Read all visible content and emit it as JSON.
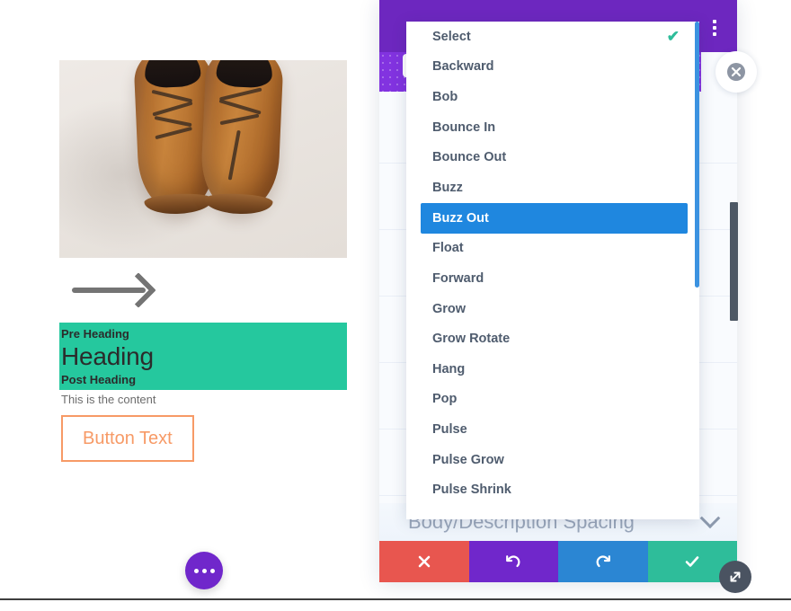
{
  "preview": {
    "photo_alt": "brown-leather-dress-shoes",
    "arrow_icon": "arrow-right-icon",
    "pre_heading": "Pre Heading",
    "heading": "Heading",
    "post_heading": "Post Heading",
    "content": "This is the content",
    "button_label": "Button Text",
    "fab_icon": "ellipsis-icon",
    "colors": {
      "heading_block_bg": "#25c89e",
      "button_border": "#f79a66",
      "button_text": "#f79a66",
      "arrow": "#747474",
      "fab_bg": "#7027cb"
    }
  },
  "modal": {
    "header_menu_icon": "vertical-ellipsis-icon",
    "row_menu_icon": "vertical-ellipsis-icon",
    "close_icon": "close-circle-icon",
    "resize_icon": "resize-diagonal-icon",
    "spacing_row": {
      "label": "Body/Description Spacing",
      "toggle_icon": "chevron-down-icon"
    },
    "footer": {
      "cancel_label": "✖",
      "cancel_icon": "cancel-x-icon",
      "undo_label": "↺",
      "undo_icon": "undo-icon",
      "redo_label": "↻",
      "redo_icon": "redo-icon",
      "save_label": "✔",
      "save_icon": "check-icon"
    },
    "colors": {
      "header_bg": "#6d27bf",
      "subheader_bg": "#8233e0",
      "cancel_bg": "#e8564f",
      "undo_bg": "#7027cb",
      "redo_bg": "#2b86d3",
      "save_bg": "#2ebd9a"
    }
  },
  "dropdown": {
    "selected_value": "Buzz Out",
    "check_glyph": "✔",
    "check_icon": "checkmark-icon",
    "scrollbar_color": "#3b92e0",
    "items": [
      {
        "label": "Select",
        "checked": true,
        "selected": false
      },
      {
        "label": "Backward",
        "checked": false,
        "selected": false
      },
      {
        "label": "Bob",
        "checked": false,
        "selected": false
      },
      {
        "label": "Bounce In",
        "checked": false,
        "selected": false
      },
      {
        "label": "Bounce Out",
        "checked": false,
        "selected": false
      },
      {
        "label": "Buzz",
        "checked": false,
        "selected": false
      },
      {
        "label": "Buzz Out",
        "checked": false,
        "selected": true
      },
      {
        "label": "Float",
        "checked": false,
        "selected": false
      },
      {
        "label": "Forward",
        "checked": false,
        "selected": false
      },
      {
        "label": "Grow",
        "checked": false,
        "selected": false
      },
      {
        "label": "Grow Rotate",
        "checked": false,
        "selected": false
      },
      {
        "label": "Hang",
        "checked": false,
        "selected": false
      },
      {
        "label": "Pop",
        "checked": false,
        "selected": false
      },
      {
        "label": "Pulse",
        "checked": false,
        "selected": false
      },
      {
        "label": "Pulse Grow",
        "checked": false,
        "selected": false
      },
      {
        "label": "Pulse Shrink",
        "checked": false,
        "selected": false
      }
    ]
  }
}
